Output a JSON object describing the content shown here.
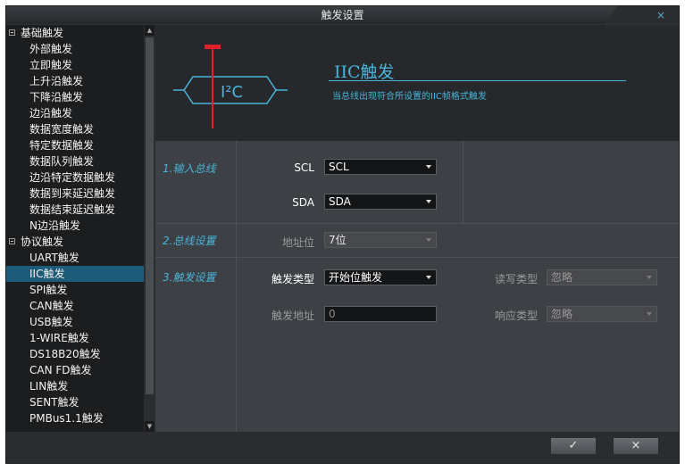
{
  "window": {
    "title": "触发设置",
    "close_icon": "×"
  },
  "sidebar": {
    "items": [
      {
        "label": "基础触发",
        "level": 0
      },
      {
        "label": "外部触发",
        "level": 1
      },
      {
        "label": "立即触发",
        "level": 1
      },
      {
        "label": "上升沿触发",
        "level": 1
      },
      {
        "label": "下降沿触发",
        "level": 1
      },
      {
        "label": "边沿触发",
        "level": 1
      },
      {
        "label": "数据宽度触发",
        "level": 1
      },
      {
        "label": "特定数据触发",
        "level": 1
      },
      {
        "label": "数据队列触发",
        "level": 1
      },
      {
        "label": "边沿特定数据触发",
        "level": 1
      },
      {
        "label": "数据到来延迟触发",
        "level": 1
      },
      {
        "label": "数据结束延迟触发",
        "level": 1
      },
      {
        "label": "N边沿触发",
        "level": 1
      },
      {
        "label": "协议触发",
        "level": 0
      },
      {
        "label": "UART触发",
        "level": 1
      },
      {
        "label": "IIC触发",
        "level": 1,
        "selected": true
      },
      {
        "label": "SPI触发",
        "level": 1
      },
      {
        "label": "CAN触发",
        "level": 1
      },
      {
        "label": "USB触发",
        "level": 1
      },
      {
        "label": "1-WIRE触发",
        "level": 1
      },
      {
        "label": "DS18B20触发",
        "level": 1
      },
      {
        "label": "CAN FD触发",
        "level": 1
      },
      {
        "label": "LIN触发",
        "level": 1
      },
      {
        "label": "SENT触发",
        "level": 1
      },
      {
        "label": "PMBus1.1触发",
        "level": 1
      }
    ]
  },
  "banner": {
    "logo_text": "I²C",
    "title": "IIC触发",
    "description": "当总线出现符合所设置的IIC帧格式触发"
  },
  "sections": {
    "input_bus": {
      "label": "1.输入总线",
      "scl_label": "SCL",
      "scl_value": "SCL",
      "sda_label": "SDA",
      "sda_value": "SDA"
    },
    "bus_settings": {
      "label": "2.总线设置",
      "address_bits_label": "地址位",
      "address_bits_value": "7位"
    },
    "trigger_settings": {
      "label": "3.触发设置",
      "trigger_type_label": "触发类型",
      "trigger_type_value": "开始位触发",
      "rw_type_label": "读写类型",
      "rw_type_value": "忽略",
      "trigger_address_label": "触发地址",
      "trigger_address_value": "0",
      "ack_type_label": "响应类型",
      "ack_type_value": "忽略"
    }
  },
  "footer": {
    "ok_label": "✓",
    "cancel_label": "×"
  },
  "colors": {
    "accent": "#49b4d8",
    "selected": "#1d5b78",
    "logo_red": "#e0202a"
  }
}
